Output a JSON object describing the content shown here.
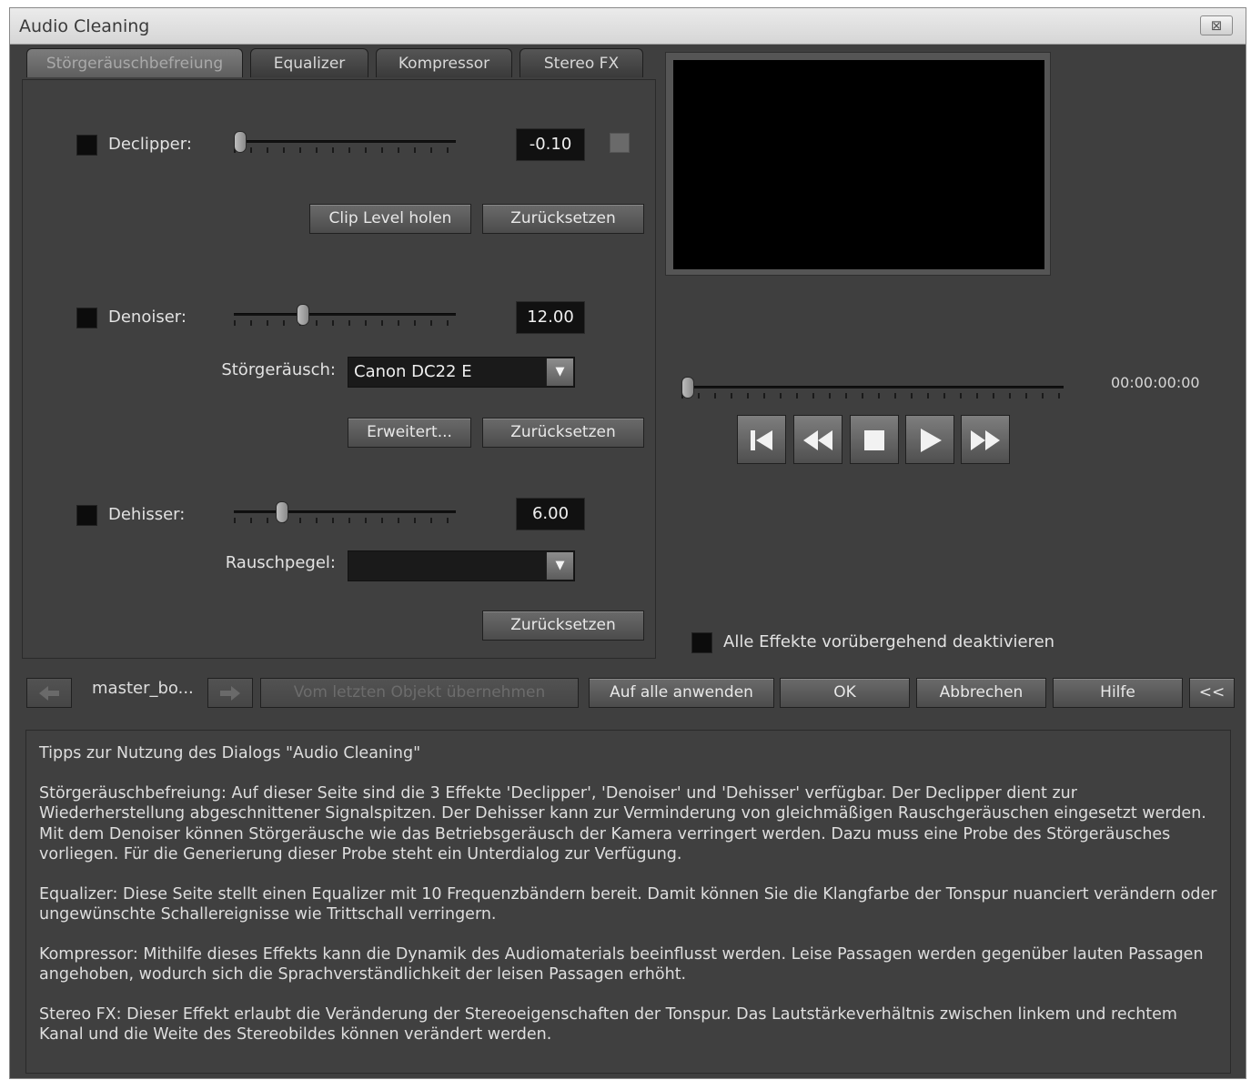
{
  "window": {
    "title": "Audio Cleaning",
    "close_glyph": "⊠"
  },
  "tabs": [
    {
      "label": "Störgeräuschbefreiung",
      "active": true
    },
    {
      "label": "Equalizer",
      "active": false
    },
    {
      "label": "Kompressor",
      "active": false
    },
    {
      "label": "Stereo FX",
      "active": false
    }
  ],
  "declipper": {
    "label": "Declipper:",
    "value": "-0.10",
    "level": 0.0,
    "enabled": false,
    "btn_clip_level": "Clip Level holen",
    "btn_reset": "Zurücksetzen"
  },
  "denoiser": {
    "label": "Denoiser:",
    "value": "12.00",
    "level": 0.3,
    "enabled": false,
    "noise_label": "Störgeräusch:",
    "noise_value": "Canon DC22 E",
    "btn_advanced": "Erweitert...",
    "btn_reset": "Zurücksetzen"
  },
  "dehisser": {
    "label": "Dehisser:",
    "value": "6.00",
    "level": 0.2,
    "enabled": false,
    "noise_level_label": "Rauschpegel:",
    "noise_level_value": "",
    "btn_reset": "Zurücksetzen"
  },
  "player": {
    "timecode": "00:00:00:00",
    "position": 0.0
  },
  "disable_all": {
    "label": "Alle Effekte vorübergehend deaktivieren",
    "checked": false
  },
  "bottom_bar": {
    "object_name": "master_bo...",
    "btn_take_last": "Vom letzten Objekt übernehmen",
    "btn_apply_all": "Auf alle anwenden",
    "btn_ok": "OK",
    "btn_cancel": "Abbrechen",
    "btn_help": "Hilfe",
    "btn_collapse": "<<"
  },
  "help": {
    "title": "Tipps zur Nutzung des Dialogs \"Audio Cleaning\"",
    "paragraphs": [
      "Störgeräuschbefreiung: Auf dieser Seite sind die 3 Effekte 'Declipper', 'Denoiser' und 'Dehisser' verfügbar. Der Declipper dient zur Wiederherstellung abgeschnittener Signalspitzen. Der Dehisser kann zur Verminderung von gleichmäßigen Rauschgeräuschen eingesetzt werden. Mit dem Denoiser können Störgeräusche wie das Betriebsgeräusch der Kamera verringert werden. Dazu muss eine Probe des Störgeräusches vorliegen. Für die Generierung dieser Probe steht ein Unterdialog zur Verfügung.",
      "Equalizer: Diese Seite stellt einen Equalizer mit 10 Frequenzbändern bereit. Damit können Sie die Klangfarbe der Tonspur nuanciert verändern oder ungewünschte Schallereignisse wie Trittschall verringern.",
      "Kompressor: Mithilfe dieses Effekts kann die Dynamik des Audiomaterials beeinflusst werden. Leise Passagen werden gegenüber lauten Passagen angehoben, wodurch sich die Sprachverständlichkeit der leisen Passagen erhöht.",
      "Stereo FX: Dieser Effekt erlaubt die Veränderung der Stereoeigenschaften der Tonspur. Das Lautstärkeverhältnis zwischen linkem und rechtem Kanal und die Weite des Stereobildes können verändert werden."
    ]
  },
  "icons": {
    "prev_object": "arrow-left-icon",
    "next_object": "arrow-right-icon",
    "skip_start": "skip-to-start-icon",
    "rewind": "rewind-icon",
    "stop": "stop-icon",
    "play": "play-icon",
    "fast_forward": "fast-forward-icon",
    "dropdown": "chevron-down-icon"
  }
}
